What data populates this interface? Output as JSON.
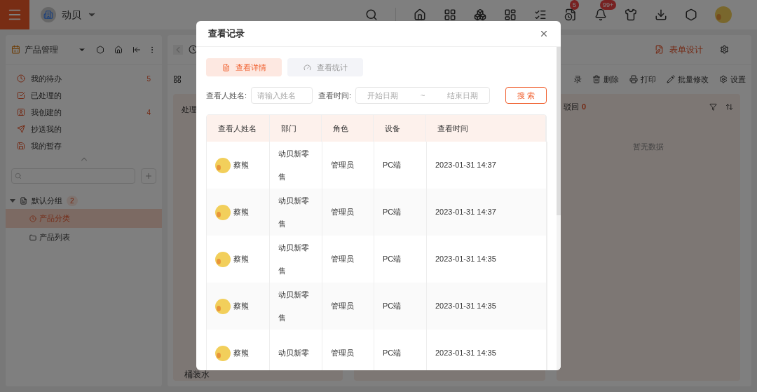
{
  "topbar": {
    "company": "动贝",
    "badges": [
      {
        "kind": "tasks",
        "count": "5"
      },
      {
        "kind": "bell",
        "count": "99+"
      }
    ]
  },
  "sidebar": {
    "title": "产品管理",
    "items": [
      {
        "kind": "todo",
        "label": "我的待办",
        "badge": "5"
      },
      {
        "kind": "done",
        "label": "已处理的"
      },
      {
        "kind": "created",
        "label": "我创建的",
        "badge": "4"
      },
      {
        "kind": "cc",
        "label": "抄送我的"
      },
      {
        "kind": "draft",
        "label": "我的暂存"
      }
    ],
    "group": {
      "label": "默认分组",
      "count": "2",
      "expanded": true,
      "children": [
        {
          "kind": "category",
          "label": "产品分类",
          "selected": true
        },
        {
          "kind": "folder",
          "label": "产品列表",
          "selected": false
        }
      ]
    }
  },
  "middle": {
    "column_title": "处理",
    "card_title": "桶装水"
  },
  "right": {
    "design_action": "表单设计",
    "toolbar": [
      {
        "kind": "record",
        "label": "录"
      },
      {
        "kind": "delete",
        "label": "删除"
      },
      {
        "kind": "print",
        "label": "打印"
      },
      {
        "kind": "edit",
        "label": "批量修改"
      },
      {
        "kind": "settings",
        "label": "设置"
      }
    ],
    "column": {
      "title": "驳回",
      "count": "0",
      "empty": "暂无数据"
    }
  },
  "modal": {
    "title": "查看记录",
    "tabs": [
      {
        "kind": "detail",
        "label": "查看详情",
        "selected": true
      },
      {
        "kind": "stats",
        "label": "查看统计",
        "selected": false
      }
    ],
    "filters": {
      "name_label": "查看人姓名:",
      "name_placeholder": "请输入姓名",
      "time_label": "查看时间:",
      "start_placeholder": "开始日期",
      "separator": "~",
      "end_placeholder": "结束日期",
      "search_button": "搜 索"
    },
    "table": {
      "columns": [
        "查看人姓名",
        "部门",
        "角色",
        "设备",
        "查看时间"
      ],
      "rows": [
        {
          "name": "蔡熊",
          "department": "动贝新零售",
          "role": "管理员",
          "device": "PC端",
          "time": "2023-01-31 14:37"
        },
        {
          "name": "蔡熊",
          "department": "动贝新零售",
          "role": "管理员",
          "device": "PC端",
          "time": "2023-01-31 14:37"
        },
        {
          "name": "蔡熊",
          "department": "动贝新零售",
          "role": "管理员",
          "device": "PC端",
          "time": "2023-01-31 14:35"
        },
        {
          "name": "蔡熊",
          "department": "动贝新零售",
          "role": "管理员",
          "device": "PC端",
          "time": "2023-01-31 14:35"
        },
        {
          "name": "蔡熊",
          "department": "动贝新零",
          "role": "管理员",
          "device": "PC端",
          "time": "2023-01-31 14:35"
        }
      ]
    }
  }
}
